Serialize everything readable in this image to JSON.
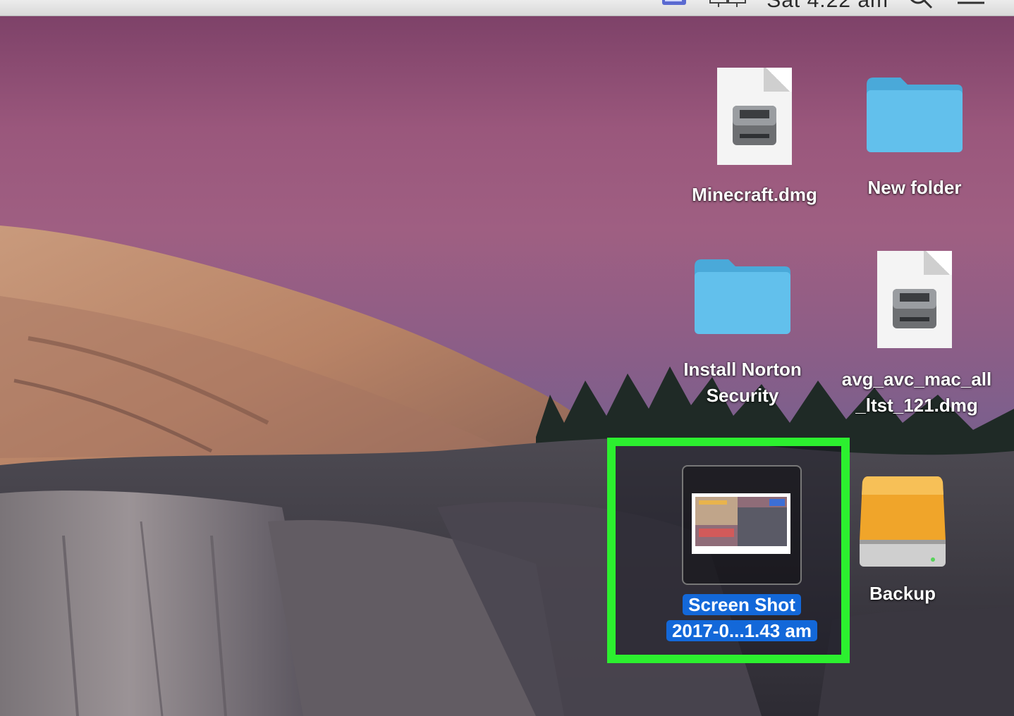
{
  "menubar": {
    "clock": "Sat 4:22 am",
    "icons": [
      "eject-drive-icon",
      "display-icon",
      "search-icon",
      "menu-list-icon"
    ]
  },
  "desktop": {
    "icons": [
      {
        "id": "minecraft",
        "label_lines": [
          "Minecraft.dmg"
        ],
        "kind": "disk-image-file"
      },
      {
        "id": "new-folder",
        "label_lines": [
          "New folder"
        ],
        "kind": "folder"
      },
      {
        "id": "norton",
        "label_lines": [
          "Install Norton",
          "Security"
        ],
        "kind": "folder"
      },
      {
        "id": "avg",
        "label_lines": [
          "avg_avc_mac_all",
          "_ltst_121.dmg"
        ],
        "kind": "disk-image-file"
      },
      {
        "id": "screenshot",
        "label_lines": [
          "Screen Shot",
          "2017-0...1.43 am"
        ],
        "kind": "image-file",
        "selected": true
      },
      {
        "id": "backup",
        "label_lines": [
          "Backup"
        ],
        "kind": "external-drive"
      }
    ]
  },
  "colors": {
    "highlight": "#2cf02f",
    "selection": "#1368d9",
    "folder": "#5bb8e6",
    "drive": "#f0a52a"
  }
}
